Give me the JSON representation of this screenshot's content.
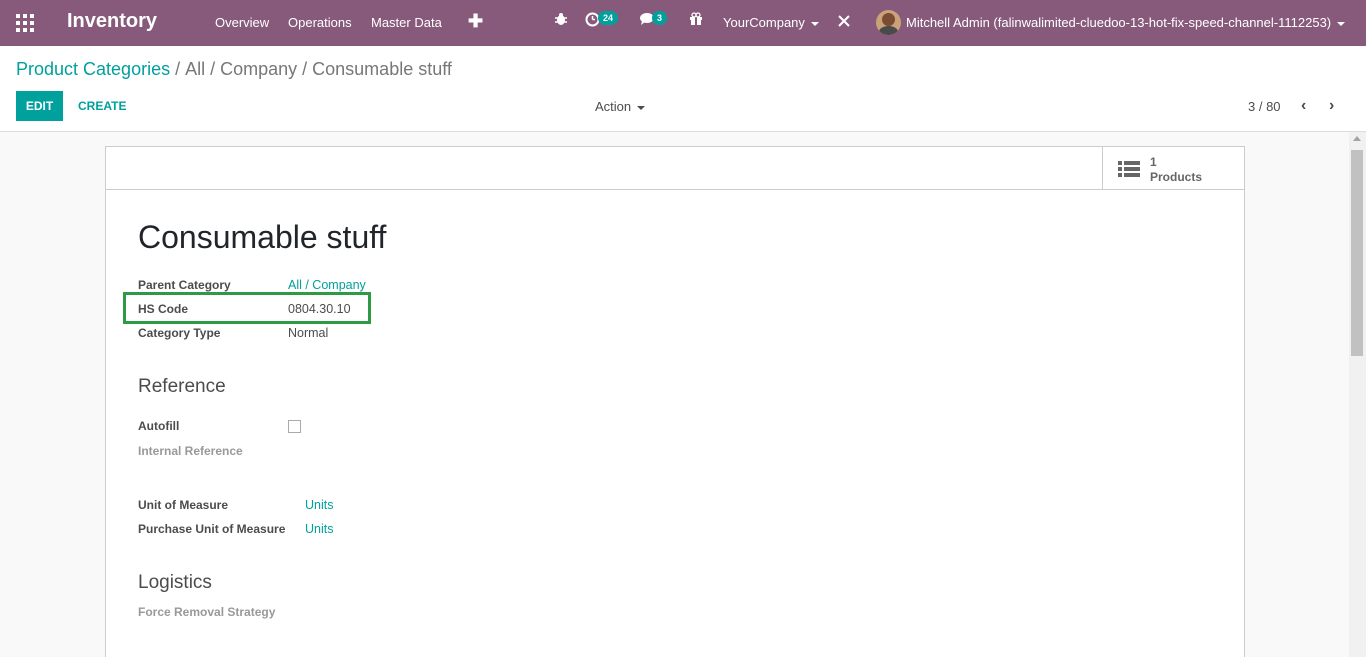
{
  "navbar": {
    "app_name": "Inventory",
    "menu": [
      "Overview",
      "Operations",
      "Master Data"
    ],
    "activity_count": "24",
    "message_count": "3",
    "company": "YourCompany",
    "user": "Mitchell Admin (falinwalimited-cluedoo-13-hot-fix-speed-channel-1112253)"
  },
  "breadcrumb": {
    "root": "Product Categories",
    "sep": "/",
    "current": "All / Company / Consumable stuff"
  },
  "toolbar": {
    "edit_label": "EDIT",
    "create_label": "CREATE",
    "action_label": "Action",
    "pager": "3 / 80"
  },
  "stat_button": {
    "value": "1",
    "label": "Products"
  },
  "form": {
    "title": "Consumable stuff",
    "parent_category_label": "Parent Category",
    "parent_category_value": "All / Company",
    "hs_code_label": "HS Code",
    "hs_code_value": "0804.30.10",
    "category_type_label": "Category Type",
    "category_type_value": "Normal",
    "reference_heading": "Reference",
    "autofill_label": "Autofill",
    "internal_reference_label": "Internal Reference",
    "uom_label": "Unit of Measure",
    "uom_value": "Units",
    "purchase_uom_label": "Purchase Unit of Measure",
    "purchase_uom_value": "Units",
    "logistics_heading": "Logistics",
    "removal_strategy_label": "Force Removal Strategy"
  },
  "colors": {
    "navbar": "#875a7b",
    "accent": "#00a09d",
    "highlight": "#2e9a44"
  }
}
